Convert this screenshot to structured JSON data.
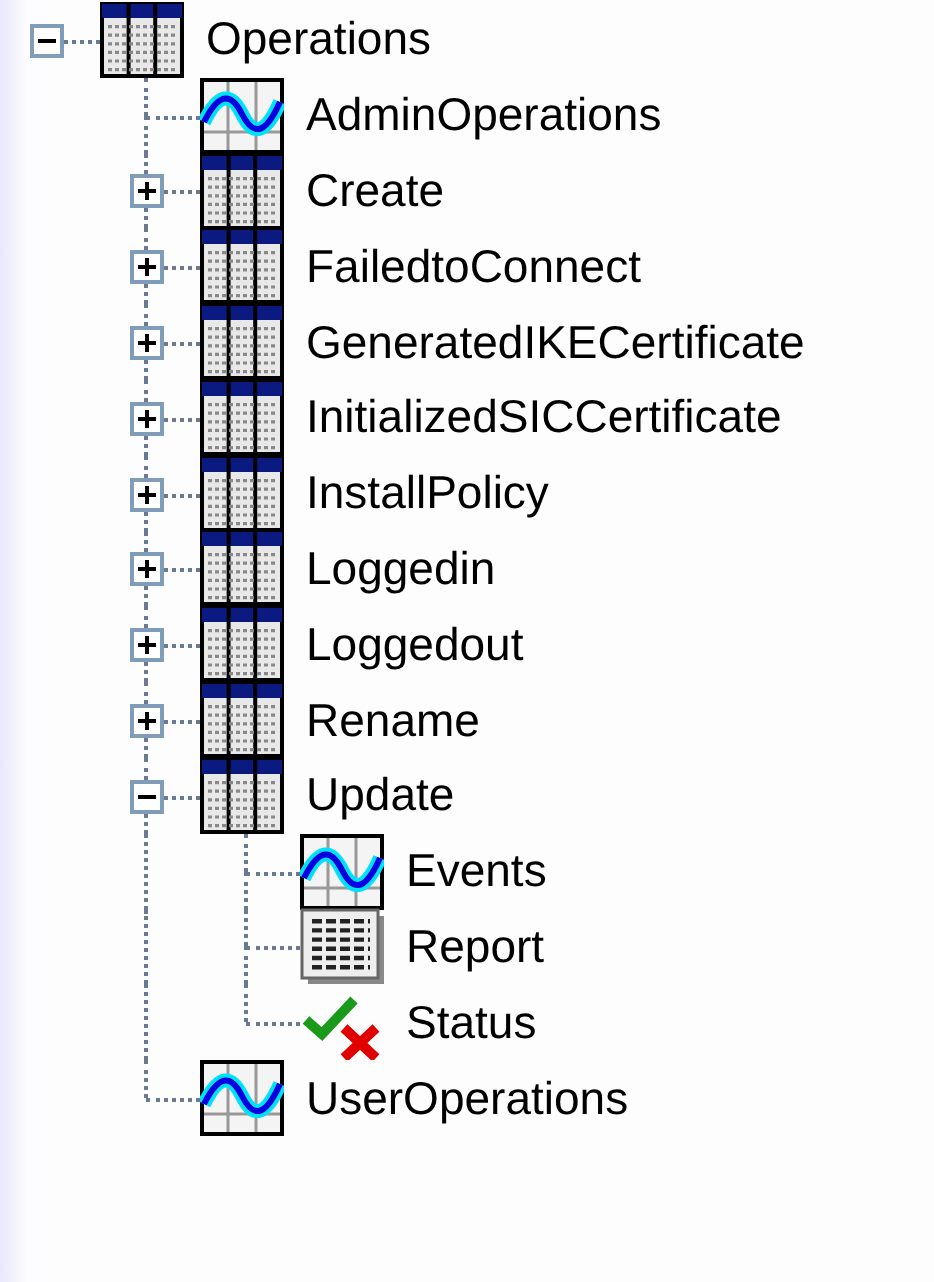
{
  "tree": [
    {
      "label": "Operations",
      "kind": "table",
      "expanded": true,
      "children": [
        {
          "label": "AdminOperations",
          "kind": "chart"
        },
        {
          "label": "Create",
          "kind": "table",
          "expanded": false
        },
        {
          "label": "FailedtoConnect",
          "kind": "table",
          "expanded": false
        },
        {
          "label": "GeneratedIKECertificate",
          "kind": "table",
          "expanded": false
        },
        {
          "label": "InitializedSICCertificate",
          "kind": "table",
          "expanded": false
        },
        {
          "label": "InstallPolicy",
          "kind": "table",
          "expanded": false
        },
        {
          "label": "Loggedin",
          "kind": "table",
          "expanded": false
        },
        {
          "label": "Loggedout",
          "kind": "table",
          "expanded": false
        },
        {
          "label": "Rename",
          "kind": "table",
          "expanded": false
        },
        {
          "label": "Update",
          "kind": "table",
          "expanded": true,
          "children": [
            {
              "label": "Events",
              "kind": "chart"
            },
            {
              "label": "Report",
              "kind": "report"
            },
            {
              "label": "Status",
              "kind": "status"
            }
          ]
        },
        {
          "label": "UserOperations",
          "kind": "chart"
        }
      ]
    }
  ]
}
